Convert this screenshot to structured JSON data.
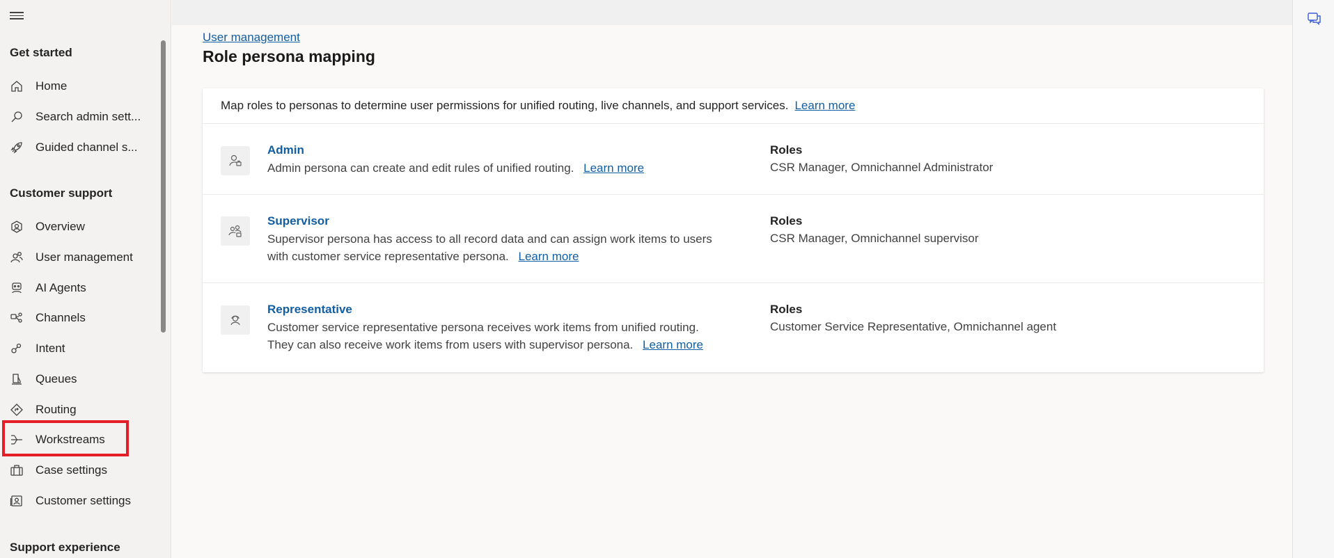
{
  "sidebar": {
    "sections": [
      {
        "title": "Get started"
      },
      {
        "title": "Customer support"
      },
      {
        "title": "Support experience"
      }
    ],
    "items": [
      {
        "label": "Home",
        "icon": "home-icon"
      },
      {
        "label": "Search admin sett...",
        "icon": "search-icon"
      },
      {
        "label": "Guided channel s...",
        "icon": "rocket-icon"
      },
      {
        "label": "Overview",
        "icon": "overview-icon"
      },
      {
        "label": "User management",
        "icon": "people-icon"
      },
      {
        "label": "AI Agents",
        "icon": "bot-icon"
      },
      {
        "label": "Channels",
        "icon": "channels-icon"
      },
      {
        "label": "Intent",
        "icon": "intent-icon"
      },
      {
        "label": "Queues",
        "icon": "queue-icon"
      },
      {
        "label": "Routing",
        "icon": "routing-icon"
      },
      {
        "label": "Workstreams",
        "icon": "workstream-icon"
      },
      {
        "label": "Case settings",
        "icon": "briefcase-icon"
      },
      {
        "label": "Customer settings",
        "icon": "contact-card-icon"
      }
    ]
  },
  "main": {
    "breadcrumb": "User management",
    "title": "Role persona mapping",
    "intro": "Map roles to personas to determine user permissions for unified routing, live channels, and support services.",
    "intro_link": "Learn more",
    "personas": [
      {
        "name": "Admin",
        "description": "Admin persona can create and edit rules of unified routing.",
        "link": "Learn more",
        "roles_label": "Roles",
        "roles": "CSR Manager, Omnichannel Administrator",
        "icon": "admin-persona-icon"
      },
      {
        "name": "Supervisor",
        "description": "Supervisor persona has access to all record data and can assign work items to users with customer service representative persona.",
        "link": "Learn more",
        "roles_label": "Roles",
        "roles": "CSR Manager, Omnichannel supervisor",
        "icon": "supervisor-persona-icon"
      },
      {
        "name": "Representative",
        "description": "Customer service representative persona receives work items from unified routing. They can also receive work items from users with supervisor persona.",
        "link": "Learn more",
        "roles_label": "Roles",
        "roles": "Customer Service Representative, Omnichannel agent",
        "icon": "representative-persona-icon"
      }
    ]
  },
  "right_rail": {
    "icon": "chat-feedback-icon"
  },
  "colors": {
    "link": "#115ea3",
    "highlight": "#e41e26"
  }
}
